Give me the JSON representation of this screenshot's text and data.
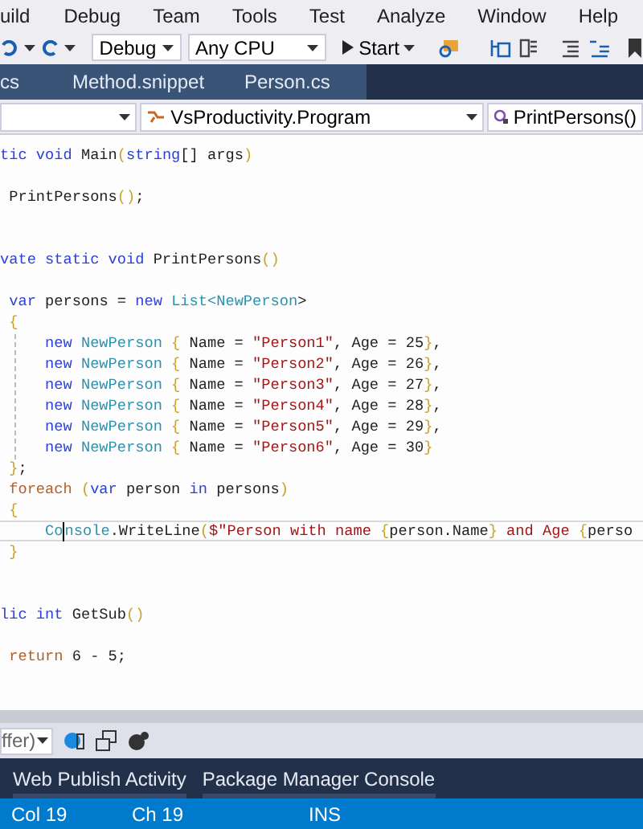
{
  "menu": [
    "uild",
    "Debug",
    "Team",
    "Tools",
    "Test",
    "Analyze",
    "Window",
    "Help"
  ],
  "toolbar": {
    "configuration": "Debug",
    "platform": "Any CPU",
    "start": "Start"
  },
  "tabs": [
    {
      "label": "cs",
      "selected": false
    },
    {
      "label": "Method.snippet",
      "selected": false
    },
    {
      "label": "Person.cs",
      "selected": false
    }
  ],
  "nav": {
    "type": "VsProductivity.Program",
    "member": "PrintPersons()"
  },
  "lines": [
    {
      "kind": "code",
      "current": false,
      "tokens": [
        {
          "kind": "kw",
          "t": "tic void "
        },
        {
          "kind": "plain",
          "t": "Main"
        },
        {
          "kind": "brace",
          "t": "("
        },
        {
          "kind": "kw",
          "t": "string"
        },
        {
          "kind": "plain",
          "t": "[] "
        },
        {
          "kind": "plain",
          "t": "args"
        },
        {
          "kind": "brace",
          "t": ")"
        }
      ]
    },
    {
      "kind": "blank"
    },
    {
      "kind": "code",
      "current": false,
      "tokens": [
        {
          "kind": "plain",
          "t": " PrintPersons"
        },
        {
          "kind": "brace",
          "t": "()"
        },
        {
          "kind": "plain",
          "t": ";"
        }
      ]
    },
    {
      "kind": "blank"
    },
    {
      "kind": "blank"
    },
    {
      "kind": "code",
      "current": false,
      "tokens": [
        {
          "kind": "kw",
          "t": "vate static void "
        },
        {
          "kind": "plain",
          "t": "PrintPersons"
        },
        {
          "kind": "brace",
          "t": "()"
        }
      ]
    },
    {
      "kind": "blank"
    },
    {
      "kind": "code",
      "current": false,
      "tokens": [
        {
          "kind": "kw",
          "t": " var "
        },
        {
          "kind": "plain",
          "t": "persons = "
        },
        {
          "kind": "kw",
          "t": "new "
        },
        {
          "kind": "type",
          "t": "List<NewPerson"
        },
        {
          "kind": "plain",
          "t": ">"
        }
      ]
    },
    {
      "kind": "code",
      "current": false,
      "tokens": [
        {
          "kind": "brace",
          "t": " {"
        }
      ]
    },
    {
      "kind": "code",
      "current": false,
      "tokens": [
        {
          "kind": "kw",
          "t": "     new "
        },
        {
          "kind": "type",
          "t": "NewPerson "
        },
        {
          "kind": "brace",
          "t": "{ "
        },
        {
          "kind": "plain",
          "t": "Name = "
        },
        {
          "kind": "str",
          "t": "\"Person1\""
        },
        {
          "kind": "plain",
          "t": ", Age = 25"
        },
        {
          "kind": "brace",
          "t": "}"
        },
        {
          "kind": "plain",
          "t": ","
        }
      ]
    },
    {
      "kind": "code",
      "current": false,
      "tokens": [
        {
          "kind": "kw",
          "t": "     new "
        },
        {
          "kind": "type",
          "t": "NewPerson "
        },
        {
          "kind": "brace",
          "t": "{ "
        },
        {
          "kind": "plain",
          "t": "Name = "
        },
        {
          "kind": "str",
          "t": "\"Person2\""
        },
        {
          "kind": "plain",
          "t": ", Age = 26"
        },
        {
          "kind": "brace",
          "t": "}"
        },
        {
          "kind": "plain",
          "t": ","
        }
      ]
    },
    {
      "kind": "code",
      "current": false,
      "tokens": [
        {
          "kind": "kw",
          "t": "     new "
        },
        {
          "kind": "type",
          "t": "NewPerson "
        },
        {
          "kind": "brace",
          "t": "{ "
        },
        {
          "kind": "plain",
          "t": "Name = "
        },
        {
          "kind": "str",
          "t": "\"Person3\""
        },
        {
          "kind": "plain",
          "t": ", Age = 27"
        },
        {
          "kind": "brace",
          "t": "}"
        },
        {
          "kind": "plain",
          "t": ","
        }
      ]
    },
    {
      "kind": "code",
      "current": false,
      "tokens": [
        {
          "kind": "kw",
          "t": "     new "
        },
        {
          "kind": "type",
          "t": "NewPerson "
        },
        {
          "kind": "brace",
          "t": "{ "
        },
        {
          "kind": "plain",
          "t": "Name = "
        },
        {
          "kind": "str",
          "t": "\"Person4\""
        },
        {
          "kind": "plain",
          "t": ", Age = 28"
        },
        {
          "kind": "brace",
          "t": "}"
        },
        {
          "kind": "plain",
          "t": ","
        }
      ]
    },
    {
      "kind": "code",
      "current": false,
      "tokens": [
        {
          "kind": "kw",
          "t": "     new "
        },
        {
          "kind": "type",
          "t": "NewPerson "
        },
        {
          "kind": "brace",
          "t": "{ "
        },
        {
          "kind": "plain",
          "t": "Name = "
        },
        {
          "kind": "str",
          "t": "\"Person5\""
        },
        {
          "kind": "plain",
          "t": ", Age = 29"
        },
        {
          "kind": "brace",
          "t": "}"
        },
        {
          "kind": "plain",
          "t": ","
        }
      ]
    },
    {
      "kind": "code",
      "current": false,
      "tokens": [
        {
          "kind": "kw",
          "t": "     new "
        },
        {
          "kind": "type",
          "t": "NewPerson "
        },
        {
          "kind": "brace",
          "t": "{ "
        },
        {
          "kind": "plain",
          "t": "Name = "
        },
        {
          "kind": "str",
          "t": "\"Person6\""
        },
        {
          "kind": "plain",
          "t": ", Age = 30"
        },
        {
          "kind": "brace",
          "t": "}"
        }
      ]
    },
    {
      "kind": "code",
      "current": false,
      "tokens": [
        {
          "kind": "brace",
          "t": " }"
        },
        {
          "kind": "plain",
          "t": ";"
        }
      ]
    },
    {
      "kind": "code",
      "current": false,
      "tokens": [
        {
          "kind": "ctrl",
          "t": " foreach "
        },
        {
          "kind": "brace",
          "t": "("
        },
        {
          "kind": "kw",
          "t": "var "
        },
        {
          "kind": "plain",
          "t": "person "
        },
        {
          "kind": "kw",
          "t": "in "
        },
        {
          "kind": "plain",
          "t": "persons"
        },
        {
          "kind": "brace",
          "t": ")"
        }
      ]
    },
    {
      "kind": "code",
      "current": false,
      "tokens": [
        {
          "kind": "brace",
          "t": " {"
        }
      ]
    },
    {
      "kind": "code",
      "current": true,
      "tokens": [
        {
          "kind": "type",
          "t": "     Co"
        },
        {
          "kind": "caret"
        },
        {
          "kind": "type",
          "t": "nsole"
        },
        {
          "kind": "plain",
          "t": ".WriteLine"
        },
        {
          "kind": "brace",
          "t": "("
        },
        {
          "kind": "str",
          "t": "$\"Person with name "
        },
        {
          "kind": "brace",
          "t": "{"
        },
        {
          "kind": "plain",
          "t": "person.Name"
        },
        {
          "kind": "brace",
          "t": "}"
        },
        {
          "kind": "str",
          "t": " and Age "
        },
        {
          "kind": "brace",
          "t": "{"
        },
        {
          "kind": "plain",
          "t": "perso"
        }
      ]
    },
    {
      "kind": "code",
      "current": false,
      "tokens": [
        {
          "kind": "brace",
          "t": " }"
        }
      ]
    },
    {
      "kind": "blank"
    },
    {
      "kind": "blank"
    },
    {
      "kind": "code",
      "current": false,
      "tokens": [
        {
          "kind": "kw",
          "t": "lic int "
        },
        {
          "kind": "plain",
          "t": "GetSub"
        },
        {
          "kind": "brace",
          "t": "()"
        }
      ]
    },
    {
      "kind": "blank"
    },
    {
      "kind": "code",
      "current": false,
      "tokens": [
        {
          "kind": "ctrl",
          "t": " return "
        },
        {
          "kind": "plain",
          "t": "6 - 5;"
        }
      ]
    }
  ],
  "output_toolbar": {
    "source": "ffer)"
  },
  "panel_tabs": [
    {
      "label": "Web Publish Activity",
      "selected": false
    },
    {
      "label": "Package Manager Console",
      "selected": false
    }
  ],
  "status_bar": {
    "col": "Col 19",
    "ch": "Ch 19",
    "mode": "INS"
  }
}
